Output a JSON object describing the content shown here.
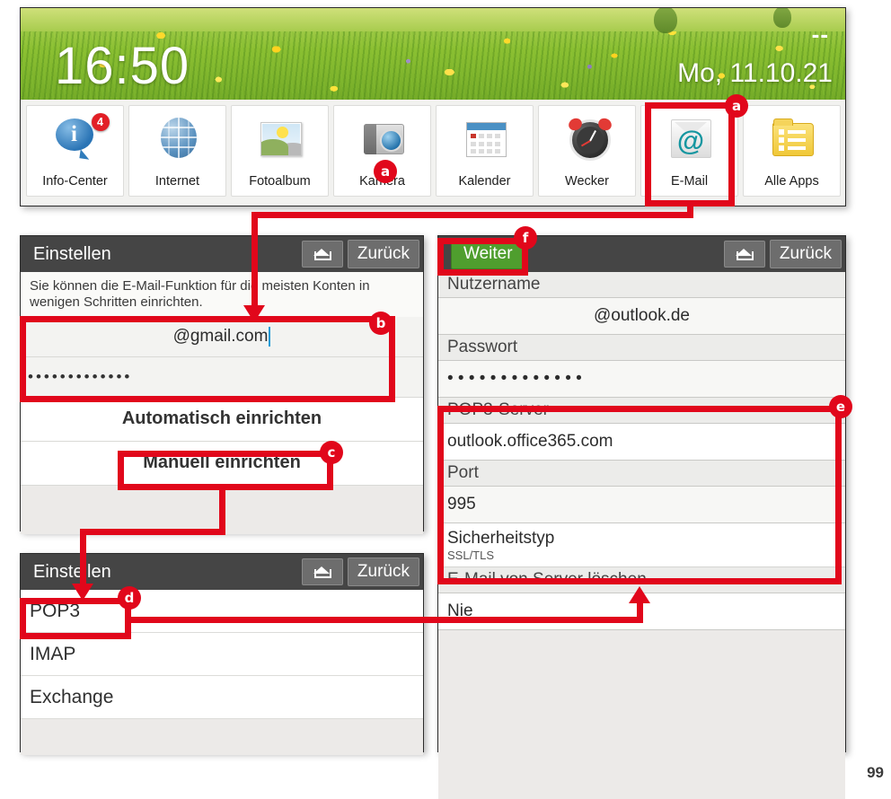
{
  "phone_home": {
    "clock": "16:50",
    "date": "Mo, 11.10.21",
    "dashes": "--",
    "apps": [
      {
        "label": "Info-Center",
        "icon": "info-bubble-icon",
        "badge": "4"
      },
      {
        "label": "Internet",
        "icon": "globe-icon",
        "badge": ""
      },
      {
        "label": "Fotoalbum",
        "icon": "photo-icon",
        "badge": ""
      },
      {
        "label": "Kamera",
        "icon": "camera-icon",
        "badge": ""
      },
      {
        "label": "Kalender",
        "icon": "calendar-icon",
        "badge": ""
      },
      {
        "label": "Wecker",
        "icon": "alarm-clock-icon",
        "badge": ""
      },
      {
        "label": "E-Mail",
        "icon": "at-envelope-icon",
        "badge": ""
      },
      {
        "label": "Alle Apps",
        "icon": "all-apps-folder-icon",
        "badge": ""
      }
    ]
  },
  "setup_screen": {
    "title": "Einstellen",
    "home_icon": "home-icon",
    "back_label": "Zurück",
    "hint": "Sie können die E-Mail-Funktion für die meisten Konten in wenigen Schritten einrichten.",
    "email_value": "@gmail.com",
    "password_value": "•••••••••••••",
    "auto_label": "Automatisch einrichten",
    "manual_label": "Manuell einrichten"
  },
  "account_type_screen": {
    "title": "Einstellen",
    "home_icon": "home-icon",
    "back_label": "Zurück",
    "options": [
      "POP3",
      "IMAP",
      "Exchange"
    ]
  },
  "server_screen": {
    "next_label": "Weiter",
    "home_icon": "home-icon",
    "back_label": "Zurück",
    "fields": [
      {
        "label": "Nutzername",
        "value": "@outlook.de",
        "centered": true,
        "sub": ""
      },
      {
        "label": "Passwort",
        "value": "• • • • • • • • • • • • •",
        "centered": false,
        "sub": ""
      },
      {
        "label": "POP3-Server",
        "value": "outlook.office365.com",
        "centered": false,
        "sub": ""
      },
      {
        "label": "Port",
        "value": "995",
        "centered": false,
        "sub": ""
      },
      {
        "label": "Sicherheitstyp",
        "value": "",
        "centered": false,
        "sub": "SSL/TLS"
      },
      {
        "label": "E-Mail von Server löschen",
        "value": "Nie",
        "centered": false,
        "sub": ""
      }
    ]
  },
  "annotations": {
    "markers": [
      "a",
      "a",
      "b",
      "c",
      "d",
      "e",
      "f"
    ],
    "accent_color": "#e1071b"
  },
  "page_number": "99"
}
